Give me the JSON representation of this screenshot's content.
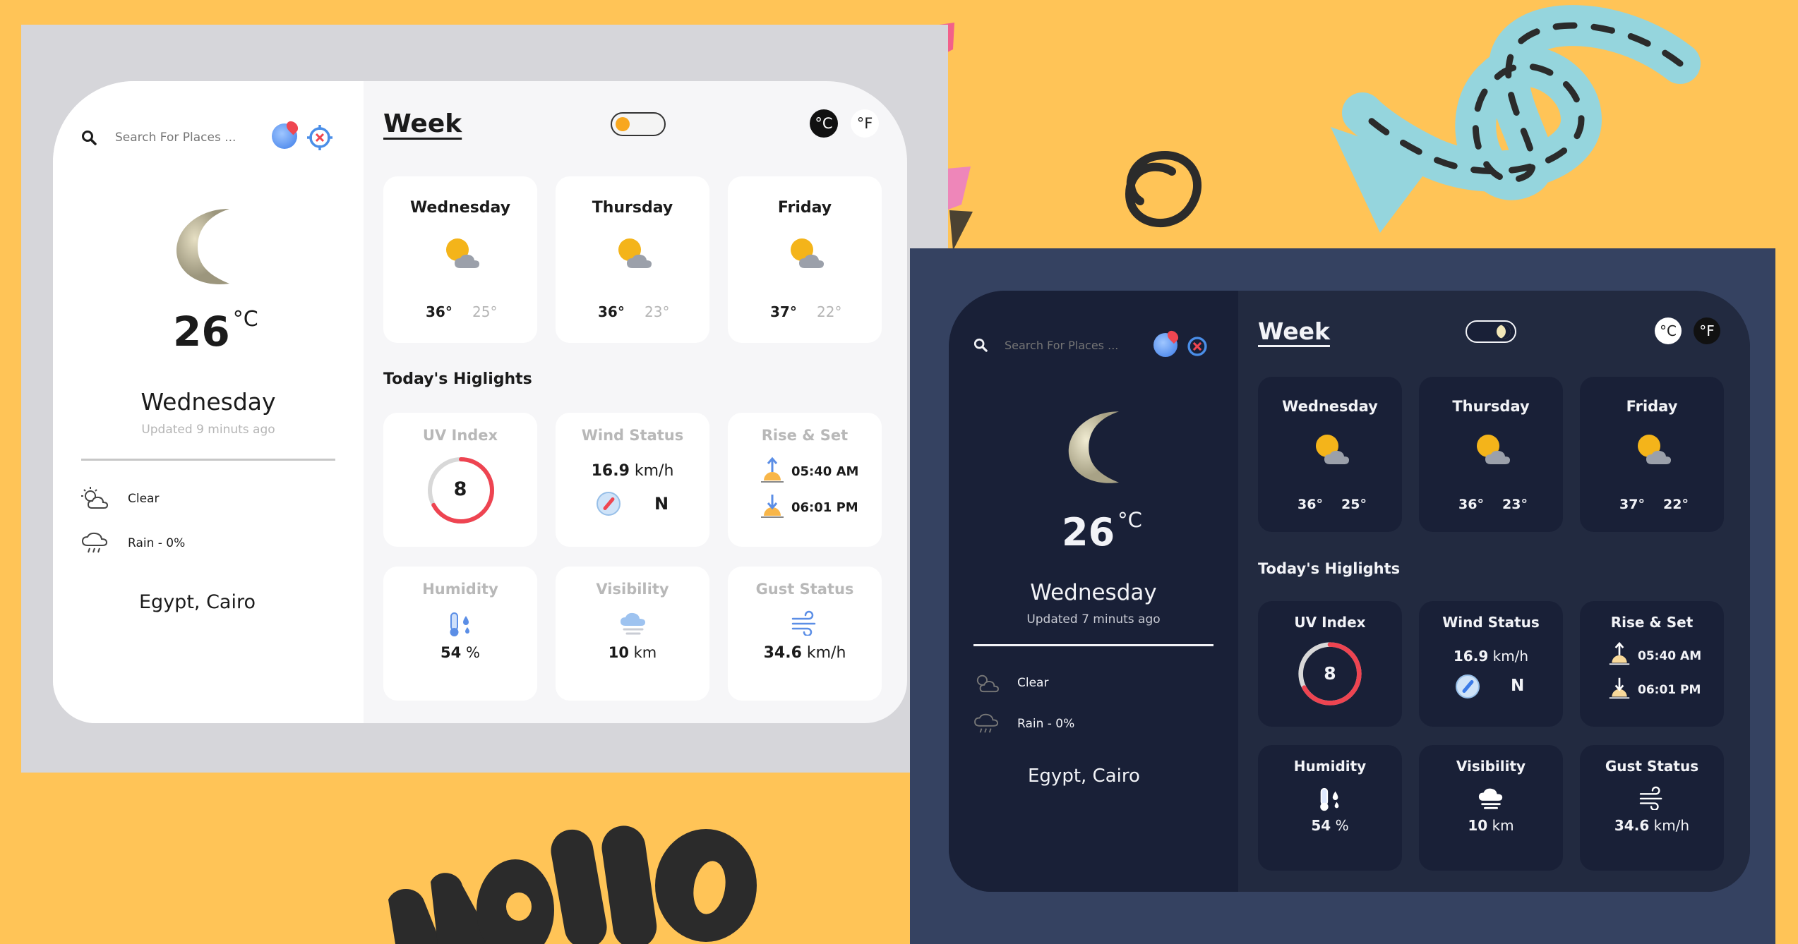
{
  "decor": {
    "hello_text": "hello"
  },
  "light": {
    "search": {
      "placeholder": "Search For Places ..."
    },
    "current": {
      "temp": "26",
      "unit": "°C",
      "day": "Wednesday",
      "updated": "Updated 9 minuts ago",
      "conditions": [
        {
          "label": "Clear",
          "icon": "partly-sunny-icon"
        },
        {
          "label": "Rain - 0%",
          "icon": "rain-cloud-icon"
        }
      ],
      "location": "Egypt, Cairo"
    },
    "week_title": "Week",
    "units": {
      "c": "°C",
      "f": "°F",
      "active": "c"
    },
    "days": [
      {
        "name": "Wednesday",
        "hi": "36°",
        "lo": "25°"
      },
      {
        "name": "Thursday",
        "hi": "36°",
        "lo": "23°"
      },
      {
        "name": "Friday",
        "hi": "37°",
        "lo": "22°"
      }
    ],
    "highlights_title": "Today's Higlights",
    "highlights": {
      "uv": {
        "title": "UV Index",
        "value": "8",
        "level": 0.67
      },
      "wind": {
        "title": "Wind Status",
        "speed": "16.9",
        "speed_unit": "km/h",
        "dir": "N"
      },
      "sun": {
        "title": "Rise & Set",
        "rise": "05:40 AM",
        "set": "06:01 PM"
      },
      "humidity": {
        "title": "Humidity",
        "value": "54",
        "unit": "%"
      },
      "visibility": {
        "title": "Visibility",
        "value": "10",
        "unit": "km"
      },
      "gust": {
        "title": "Gust Status",
        "value": "34.6",
        "unit": "km/h"
      }
    }
  },
  "dark": {
    "search": {
      "placeholder": "Search For Places ..."
    },
    "current": {
      "temp": "26",
      "unit": "°C",
      "day": "Wednesday",
      "updated": "Updated 7 minuts ago",
      "conditions": [
        {
          "label": "Clear",
          "icon": "partly-sunny-icon"
        },
        {
          "label": "Rain - 0%",
          "icon": "rain-cloud-icon"
        }
      ],
      "location": "Egypt, Cairo"
    },
    "week_title": "Week",
    "units": {
      "c": "°C",
      "f": "°F",
      "active": "f"
    },
    "days": [
      {
        "name": "Wednesday",
        "hi": "36°",
        "lo": "25°"
      },
      {
        "name": "Thursday",
        "hi": "36°",
        "lo": "23°"
      },
      {
        "name": "Friday",
        "hi": "37°",
        "lo": "22°"
      }
    ],
    "highlights_title": "Today's Higlights",
    "highlights": {
      "uv": {
        "title": "UV Index",
        "value": "8",
        "level": 0.67
      },
      "wind": {
        "title": "Wind Status",
        "speed": "16.9",
        "speed_unit": "km/h",
        "dir": "N"
      },
      "sun": {
        "title": "Rise & Set",
        "rise": "05:40 AM",
        "set": "06:01 PM"
      },
      "humidity": {
        "title": "Humidity",
        "value": "54",
        "unit": "%"
      },
      "visibility": {
        "title": "Visibility",
        "value": "10",
        "unit": "km"
      },
      "gust": {
        "title": "Gust Status",
        "value": "34.6",
        "unit": "km/h"
      }
    }
  },
  "colors": {
    "background": "#FFC457",
    "light_frame": "#D6D6DA",
    "dark_frame": "#354261",
    "uv_ring": "#EE4451",
    "sun": "#F4B41A",
    "swirl": "#95D5DD"
  }
}
